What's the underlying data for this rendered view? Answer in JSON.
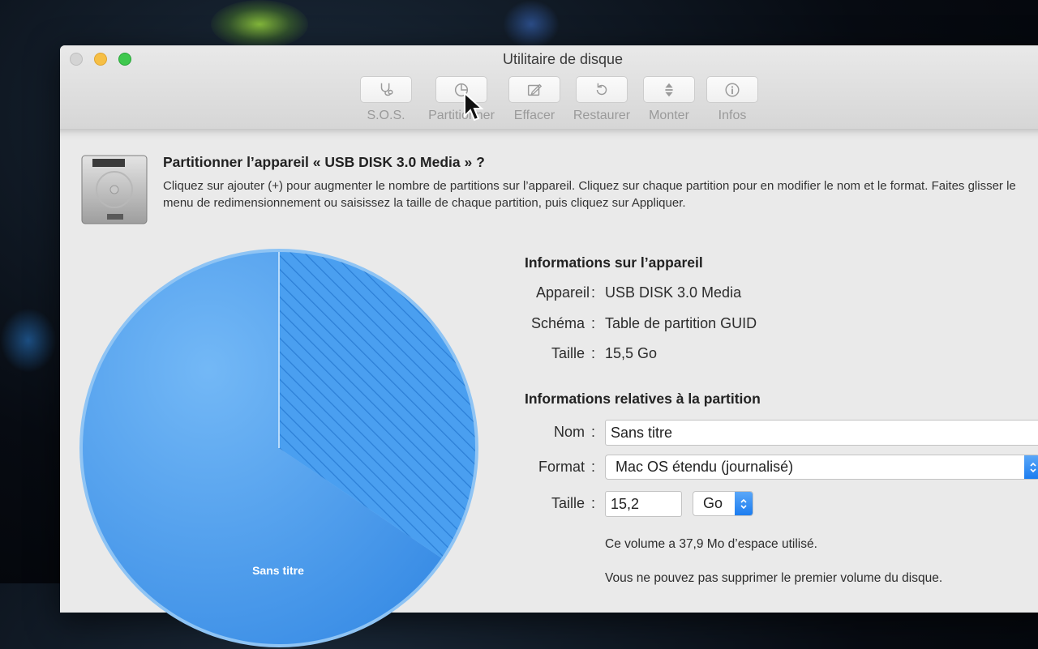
{
  "window": {
    "title": "Utilitaire de disque"
  },
  "toolbar": {
    "items": [
      {
        "label": "S.O.S.",
        "icon": "stethoscope-icon"
      },
      {
        "label": "Partitionner",
        "icon": "pie-chart-icon"
      },
      {
        "label": "Effacer",
        "icon": "erase-icon"
      },
      {
        "label": "Restaurer",
        "icon": "restore-icon"
      },
      {
        "label": "Monter",
        "icon": "mount-icon"
      },
      {
        "label": "Infos",
        "icon": "info-icon"
      }
    ]
  },
  "dialog": {
    "title": "Partitionner l’appareil « USB DISK 3.0 Media » ?",
    "description": "Cliquez sur ajouter (+) pour augmenter le nombre de partitions sur l’appareil. Cliquez sur chaque partition pour en modifier le nom et le format. Faites glisser le menu de redimensionnement ou saisissez la taille de chaque partition, puis cliquez sur Appliquer."
  },
  "pie": {
    "label": "Sans titre",
    "used_color": "#5aa9f0",
    "accent_color": "#3a92e8",
    "used_fraction": 0.6,
    "free_fraction": 0.4
  },
  "device_info": {
    "heading": "Informations sur l’appareil",
    "rows": [
      {
        "label": "Appareil",
        "value": "USB DISK 3.0 Media"
      },
      {
        "label": "Schéma",
        "value": "Table de partition GUID"
      },
      {
        "label": "Taille",
        "value": "15,5 Go"
      }
    ]
  },
  "partition_info": {
    "heading": "Informations relatives à la partition",
    "name_label": "Nom",
    "name_value": "Sans titre",
    "format_label": "Format",
    "format_value": "Mac OS étendu (journalisé)",
    "size_label": "Taille",
    "size_value": "15,2",
    "unit_value": "Go",
    "note_used": "Ce volume a 37,9 Mo d’espace utilisé.",
    "note_delete": "Vous ne pouvez pas supprimer le premier volume du disque."
  }
}
